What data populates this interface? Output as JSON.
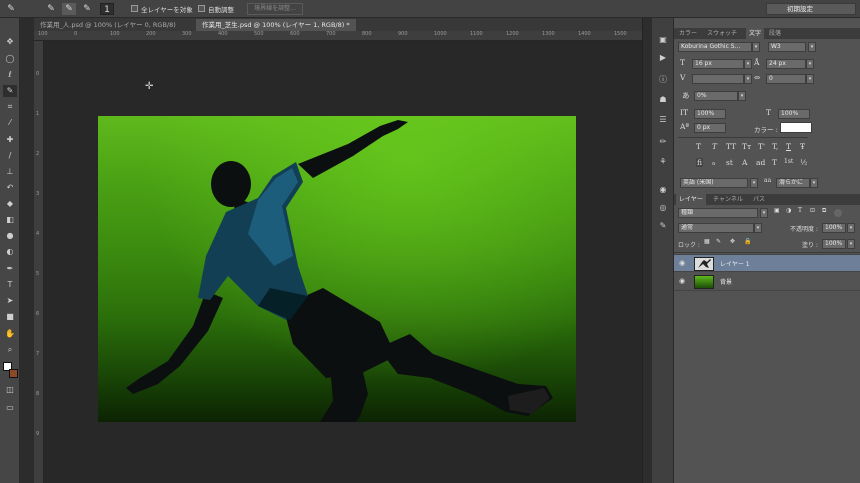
{
  "options_bar": {
    "tool_icon": "quick-selection-icon",
    "brush_size": "1",
    "sample_all_layers_label": "全レイヤーを対象",
    "auto_enhance_label": "自動調整",
    "refine_edge_label": "境界線を調整...",
    "workspace_preset": "初期設定"
  },
  "documents": {
    "tabs": [
      {
        "label": "作業用_人.psd @ 100% (レイヤー 0, RGB/8)",
        "active": false
      },
      {
        "label": "作業用_芝生.psd @ 100% (レイヤー 1, RGB/8) *",
        "active": true
      }
    ]
  },
  "ruler": {
    "top_ticks": [
      "100",
      "0",
      "100",
      "200",
      "300",
      "400",
      "500",
      "600",
      "700",
      "800",
      "900",
      "1000",
      "1100",
      "1200",
      "1300",
      "1400",
      "1500"
    ],
    "left_ticks": [
      "0",
      "1",
      "2",
      "3",
      "4",
      "5",
      "6",
      "7",
      "8",
      "9"
    ]
  },
  "tools": [
    "move-icon",
    "marquee-icon",
    "lasso-icon",
    "quick-select-icon",
    "crop-icon",
    "eyedropper-icon",
    "healing-icon",
    "brush-icon",
    "stamp-icon",
    "history-brush-icon",
    "eraser-icon",
    "gradient-icon",
    "blur-icon",
    "dodge-icon",
    "pen-icon",
    "type-icon",
    "path-select-icon",
    "shape-icon",
    "hand-icon",
    "zoom-icon"
  ],
  "type_panel": {
    "tabs": [
      "カラー",
      "スウォッチ",
      "文字",
      "段落"
    ],
    "active_tab": "文字",
    "font_family": "Koburina Gothic S...",
    "font_style": "W3",
    "font_size": "16 px",
    "leading": "24 px",
    "kerning": "",
    "tracking": "0",
    "tsume": "0%",
    "vertical_scale": "100%",
    "horizontal_scale": "100%",
    "baseline_shift": "0 px",
    "color_label": "カラー :",
    "text_color": "#ffffff",
    "style_buttons": [
      "T",
      "T",
      "TT",
      "Tт",
      "T'",
      "T,",
      "T",
      "Ŧ"
    ],
    "opentype_buttons": [
      "fi",
      "ℴ",
      "st",
      "A",
      "ad",
      "T",
      "1st",
      "½"
    ],
    "language": "英語 (米国)",
    "antialias": "滑らかに"
  },
  "layers_panel": {
    "tabs": [
      "レイヤー",
      "チャンネル",
      "パス"
    ],
    "filter_kind": "種類",
    "blend_mode": "通常",
    "opacity_label": "不透明度 :",
    "opacity": "100%",
    "lock_label": "ロック :",
    "fill_label": "塗り :",
    "fill": "100%",
    "layers": [
      {
        "name": "レイヤー 1",
        "selected": true
      },
      {
        "name": "背景",
        "selected": false
      }
    ]
  }
}
